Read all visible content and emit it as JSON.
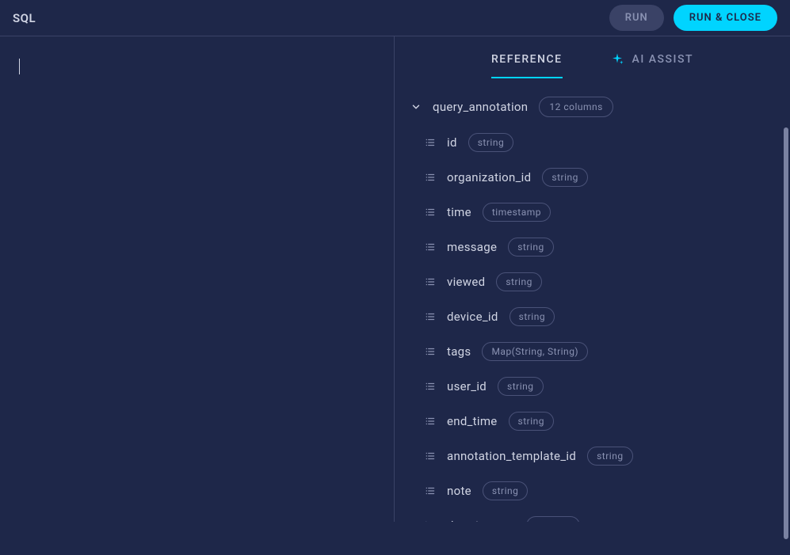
{
  "header": {
    "title": "SQL",
    "run_label": "RUN",
    "run_close_label": "RUN & CLOSE"
  },
  "tabs": {
    "reference_label": "REFERENCE",
    "ai_assist_label": "AI ASSIST"
  },
  "table": {
    "name": "query_annotation",
    "columns_count_label": "12 columns",
    "columns": [
      {
        "name": "id",
        "type": "string",
        "icon": "list"
      },
      {
        "name": "organization_id",
        "type": "string",
        "icon": "list"
      },
      {
        "name": "time",
        "type": "timestamp",
        "icon": "list"
      },
      {
        "name": "message",
        "type": "string",
        "icon": "list"
      },
      {
        "name": "viewed",
        "type": "string",
        "icon": "list"
      },
      {
        "name": "device_id",
        "type": "string",
        "icon": "list"
      },
      {
        "name": "tags",
        "type": "Map(String, String)",
        "icon": "list"
      },
      {
        "name": "user_id",
        "type": "string",
        "icon": "list"
      },
      {
        "name": "end_time",
        "type": "string",
        "icon": "list"
      },
      {
        "name": "annotation_template_id",
        "type": "string",
        "icon": "list"
      },
      {
        "name": "note",
        "type": "string",
        "icon": "list"
      },
      {
        "name": "duration_ms",
        "type": "number",
        "icon": "scatter"
      }
    ]
  }
}
